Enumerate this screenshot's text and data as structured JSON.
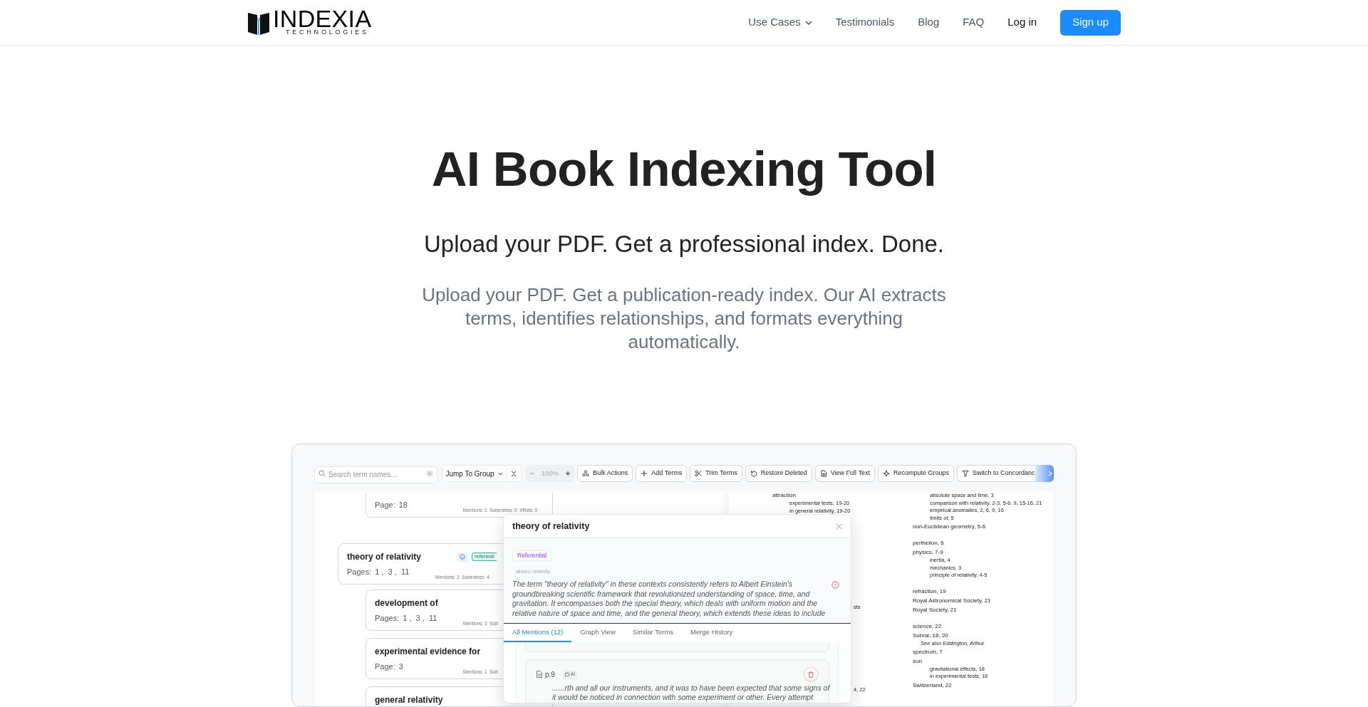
{
  "nav": {
    "logo": {
      "name": "INDEXIA",
      "tagline": "TECHNOLOGIES"
    },
    "links": [
      {
        "label": "Use Cases",
        "dropdown": true
      },
      {
        "label": "Testimonials",
        "dropdown": false
      },
      {
        "label": "Blog",
        "dropdown": false
      },
      {
        "label": "FAQ",
        "dropdown": false
      }
    ],
    "login": "Log in",
    "signup": "Sign up"
  },
  "hero": {
    "title": "AI Book Indexing Tool",
    "subtitle": "Upload your PDF. Get a professional index. Done.",
    "description": "Upload your PDF. Get a publication-ready index. Our AI extracts terms, identifies relationships, and formats everything automatically."
  },
  "app": {
    "toolbar": {
      "search_placeholder": "Search term names...",
      "jump": "Jump To Group",
      "zoom": "100%",
      "buttons": [
        "Bulk Actions",
        "Add Terms",
        "Trim Terms",
        "Restore Deleted",
        "View Full Text",
        "Recompute Groups",
        "Switch to Concordanc"
      ]
    },
    "terms": [
      {
        "children": [
          {
            "pages_label": "Page:",
            "pages": "18",
            "stats": "Mentions: 1  Subentries: 0  XRefs: 0"
          }
        ]
      },
      {
        "title": "theory of relativity",
        "tag": "referenti",
        "pages_label": "Pages:",
        "pages": "1 ,  3 ,  11",
        "stats": "Mentions: 3  Subentries: 4",
        "children": [
          {
            "title": "development of",
            "pages_label": "Pages:",
            "pages": "1 ,  3 ,  11",
            "stats": "Mentions: 3  Sub"
          },
          {
            "title": "experimental evidence for",
            "pages_label": "Page:",
            "pages": "3",
            "stats": "Mentions: 1  Sub"
          },
          {
            "title": "general relativity"
          }
        ]
      }
    ],
    "popup": {
      "title": "theory of relativity",
      "type": "Referential",
      "aliases": "aliases: relativity",
      "description": "The term \"theory of relativity\" in these contexts consistently refers to Albert Einstein's groundbreaking scientific framework that revolutionized understanding of space, time, and gravitation. It encompasses both the special theory, which deals with uniform motion and the relative nature of space and time, and the general theory, which extends these ideas to include",
      "tabs": [
        {
          "label": "All Mentions (12)",
          "selected": true
        },
        {
          "label": "Graph View",
          "selected": false
        },
        {
          "label": "Similar Terms",
          "selected": false
        },
        {
          "label": "Merge History",
          "selected": false
        }
      ],
      "mentions": [
        {
          "page": "p.9",
          "source": "AI",
          "excerpt": "......rth and all our instruments, and it was to have been expected that some signs of it would be noticed in connection with some experiment or other. Every attempt"
        }
      ]
    },
    "index": {
      "left": {
        "entries": [
          {
            "text": "attraction",
            "subentries": [
              "experimental tests, 19-20",
              "in general relativity, 19-20"
            ]
          }
        ],
        "fragments": [
          "sts",
          "4, 22"
        ]
      },
      "right": {
        "groups": [
          {
            "entries": [
              {
                "subentries": [
                  "absolute space and time, 3",
                  "comparison with relativity, 2-3, 5-6, 9, 15-16, 21",
                  "empirical anomalies, 2, 6, 9, 16",
                  "limits of, 5"
                ]
              },
              {
                "text": "non-Euclidean geometry, 5-6"
              }
            ]
          },
          {
            "entries": [
              {
                "text": "perihelion, 6"
              },
              {
                "text": "physics, 7-9",
                "subentries": [
                  "inertia, 4",
                  "mechanics, 3",
                  "principle of relativity, 4-5"
                ]
              }
            ]
          },
          {
            "entries": [
              {
                "text": "refraction, 19"
              },
              {
                "text": "Royal Astronomical Society, 21"
              },
              {
                "text": "Royal Society, 21"
              }
            ]
          },
          {
            "entries": [
              {
                "text": "science, 22"
              },
              {
                "text": "Sobral, 18, 20",
                "see_also": "See also Eddington, Arthur"
              },
              {
                "text": "spectrum, 7"
              },
              {
                "text": "sun",
                "subentries": [
                  "gravitational effects, 18",
                  "in experimental tests, 18"
                ]
              },
              {
                "text": "Switzerland, 22"
              }
            ]
          }
        ]
      }
    }
  }
}
